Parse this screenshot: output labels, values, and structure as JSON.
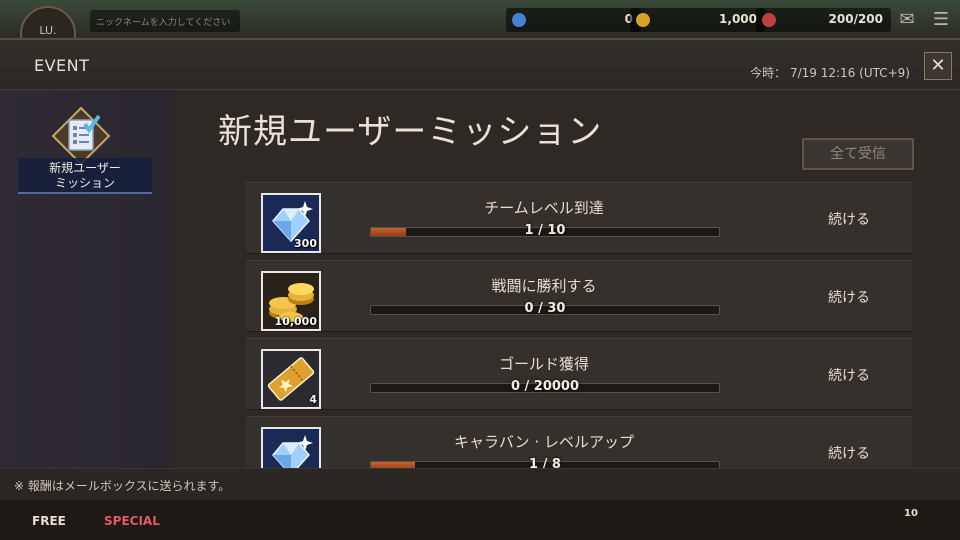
{
  "hud": {
    "level_label": "LU.",
    "name_placeholder": "ニックネームを入力してください",
    "gems": "0",
    "gold": "1,000",
    "stamina": "200/200",
    "colors": {
      "gem": "#4a7fd0",
      "gold": "#d8a22a",
      "stamina": "#c04040"
    }
  },
  "header": {
    "event_title": "EVENT",
    "time_label": "今時： 7/19 12:16 (UTC+9)",
    "close_symbol": "✕"
  },
  "sidebar": {
    "items": [
      {
        "label_line1": "新規ユーザー",
        "label_line2": "ミッション",
        "icon": "checklist-icon"
      }
    ]
  },
  "main": {
    "title": "新規ユーザーミッション",
    "claim_all_label": "全て受信",
    "missions": [
      {
        "name": "チームレベル到達",
        "progress_text": "1 / 10",
        "progress": 0.1,
        "reward_icon": "diamond-icon",
        "reward_count": "300",
        "action": "続ける"
      },
      {
        "name": "戦闘に勝利する",
        "progress_text": "0 / 30",
        "progress": 0.0,
        "reward_icon": "gold-coins-icon",
        "reward_count": "10,000",
        "action": "続ける"
      },
      {
        "name": "ゴールド獲得",
        "progress_text": "0 / 20000",
        "progress": 0.0,
        "reward_icon": "ticket-icon",
        "reward_count": "4",
        "action": "続ける"
      },
      {
        "name": "キャラバン · レベルアップ",
        "progress_text": "1 / 8",
        "progress": 0.125,
        "reward_icon": "diamond-icon",
        "reward_count": "",
        "action": "続ける"
      }
    ]
  },
  "footer": {
    "note": "※ 報酬はメールボックスに送られます。"
  },
  "bottom": {
    "free_label": "FREE",
    "special_label": "SPECIAL",
    "badge": "10"
  }
}
